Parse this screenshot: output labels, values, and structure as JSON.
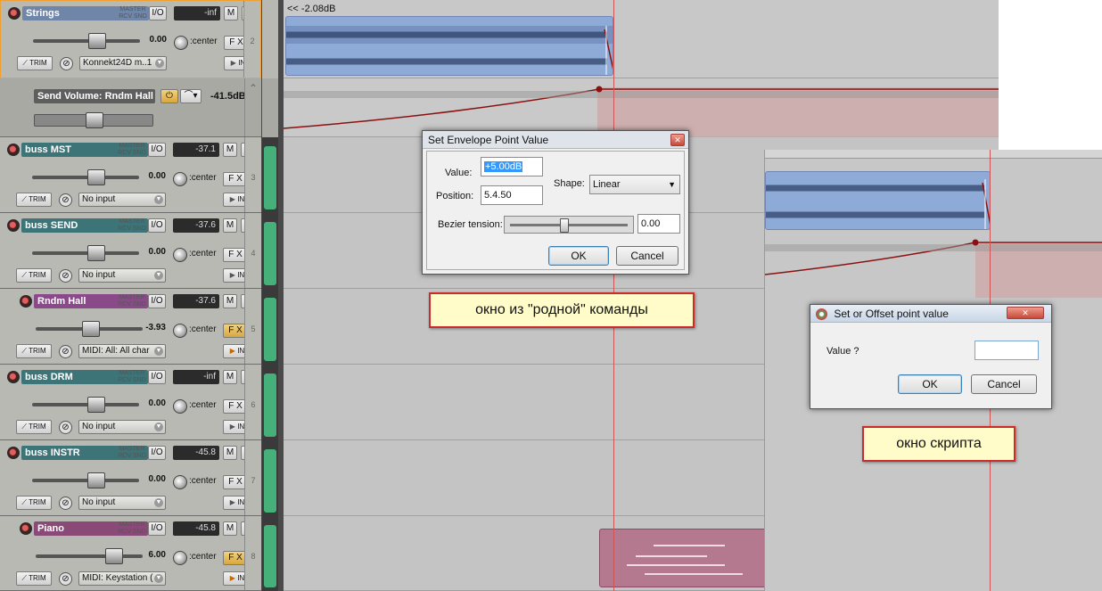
{
  "tracks": [
    {
      "name": "Strings",
      "name_color": "#6f86a8",
      "route": [
        "MASTER",
        "RCV",
        "SND"
      ],
      "io": "I/O",
      "meter": "-inf",
      "m": "M",
      "s": "S",
      "volume": "0.00",
      "pan": "center",
      "fx": "F X",
      "fx_on": false,
      "trim": "TRIM",
      "input": "Konnekt24D m..1",
      "mon": "IN",
      "mon_on": false,
      "number": "2"
    },
    {
      "name": "buss MST",
      "name_color": "#3c7478",
      "route": [
        "MASTER",
        "RCV",
        "SND"
      ],
      "io": "I/O",
      "meter": "-37.1",
      "m": "M",
      "s": "S",
      "volume": "0.00",
      "pan": "center",
      "fx": "F X",
      "fx_on": false,
      "trim": "TRIM",
      "input": "No input",
      "mon": "IN",
      "mon_on": false,
      "number": "3"
    },
    {
      "name": "buss SEND",
      "name_color": "#3c7478",
      "route": [
        "MASTER",
        "RCV",
        "SND"
      ],
      "io": "I/O",
      "meter": "-37.6",
      "m": "M",
      "s": "S",
      "volume": "0.00",
      "pan": "center",
      "fx": "F X",
      "fx_on": false,
      "trim": "TRIM",
      "input": "No input",
      "mon": "IN",
      "mon_on": false,
      "number": "4"
    },
    {
      "name": "Rndm Hall",
      "name_color": "#8a4a8a",
      "route": [
        "MASTER",
        "RCV",
        "SND"
      ],
      "io": "I/O",
      "meter": "-37.6",
      "m": "M",
      "s": "S",
      "volume": "-3.93",
      "pan": "center",
      "fx": "F X",
      "fx_on": true,
      "trim": "TRIM",
      "input": "MIDI: All: All char",
      "mon": "IN",
      "mon_on": true,
      "number": "5"
    },
    {
      "name": "buss DRM",
      "name_color": "#3c7478",
      "route": [
        "MASTER",
        "RCV",
        "SND"
      ],
      "io": "I/O",
      "meter": "-inf",
      "m": "M",
      "s": "S",
      "volume": "0.00",
      "pan": "center",
      "fx": "F X",
      "fx_on": false,
      "trim": "TRIM",
      "input": "No input",
      "mon": "IN",
      "mon_on": false,
      "number": "6"
    },
    {
      "name": "buss INSTR",
      "name_color": "#3c7478",
      "route": [
        "MASTER",
        "RCV",
        "SND"
      ],
      "io": "I/O",
      "meter": "-45.8",
      "m": "M",
      "s": "S",
      "volume": "0.00",
      "pan": "center",
      "fx": "F X",
      "fx_on": false,
      "trim": "TRIM",
      "input": "No input",
      "mon": "IN",
      "mon_on": false,
      "number": "7"
    },
    {
      "name": "Piano",
      "name_color": "#8a4a78",
      "route": [
        "MASTER",
        "RCV",
        "SND"
      ],
      "io": "I/O",
      "meter": "-45.8",
      "m": "M",
      "s": "S",
      "volume": "6.00",
      "pan": "center",
      "fx": "F X",
      "fx_on": true,
      "trim": "TRIM",
      "input": "MIDI: Keystation (",
      "mon": "IN",
      "mon_on": true,
      "number": "8"
    }
  ],
  "envelope": {
    "name": "Send Volume: Rndm Hall",
    "value": "-41.5dB"
  },
  "arrange": {
    "item_label": "<< -2.08dB"
  },
  "native_dialog": {
    "title": "Set Envelope Point Value",
    "value_label": "Value:",
    "value": "+5.00dB",
    "position_label": "Position:",
    "position": "5.4.50",
    "shape_label": "Shape:",
    "shape": "Linear",
    "bezier_label": "Bezier tension:",
    "bezier_value": "0.00",
    "ok": "OK",
    "cancel": "Cancel"
  },
  "script_dialog": {
    "title": "Set or Offset point value",
    "value_label": "Value ?",
    "value": "",
    "ok": "OK",
    "cancel": "Cancel"
  },
  "callouts": {
    "native": "окно из \"родной\" команды",
    "script": "окно скрипта"
  },
  "colors": {
    "accent_red": "#cc2b2b",
    "envelope": "#8b1010",
    "item_blue": "#8eabd8",
    "folder_green": "#45b07a"
  }
}
